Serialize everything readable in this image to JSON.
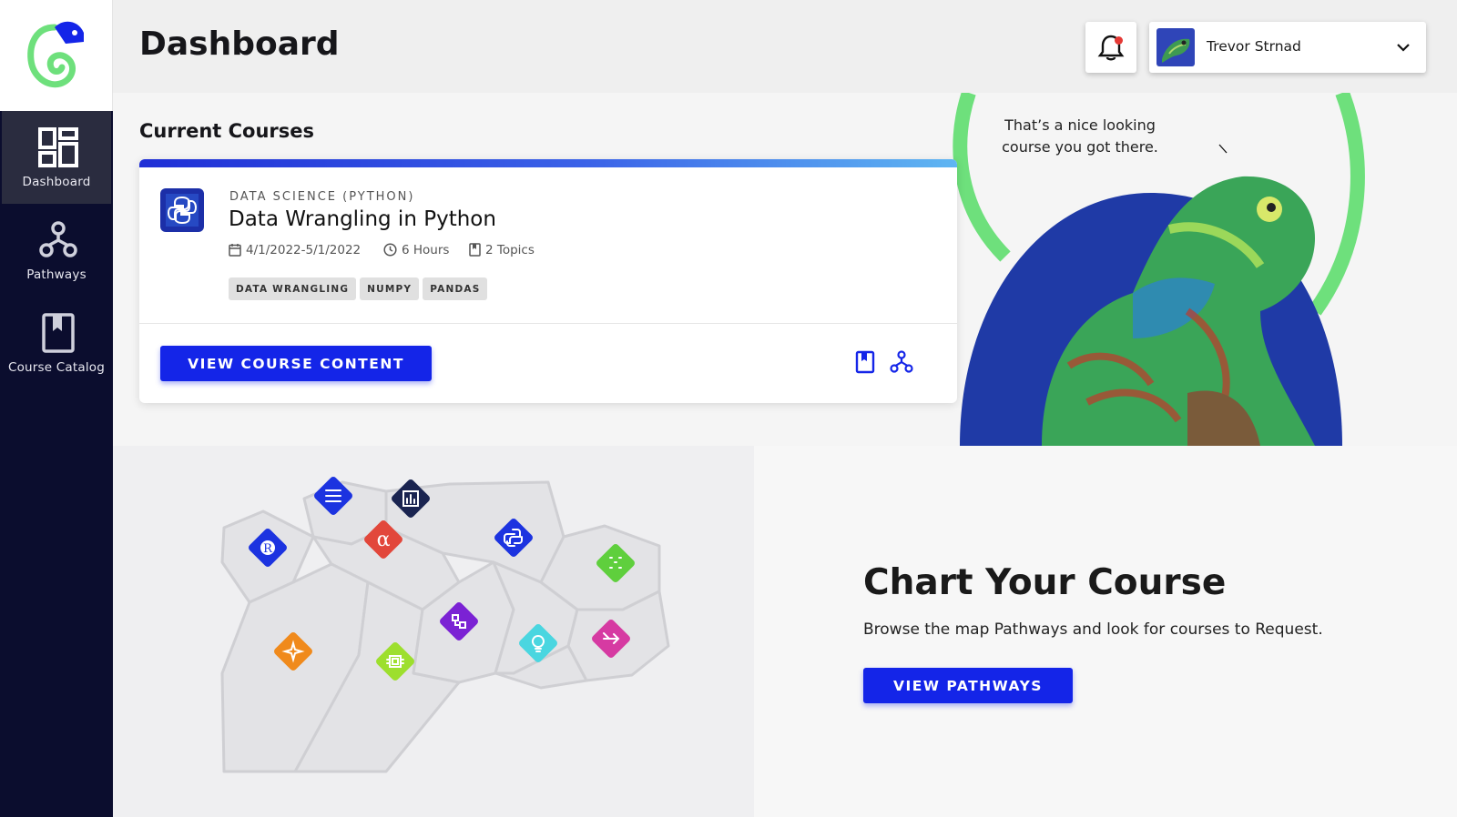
{
  "sidebar": {
    "items": [
      {
        "label": "Dashboard",
        "icon": "dashboard-grid-icon",
        "active": true
      },
      {
        "label": "Pathways",
        "icon": "pathways-nodes-icon",
        "active": false
      },
      {
        "label": "Course Catalog",
        "icon": "bookmark-book-icon",
        "active": false
      }
    ]
  },
  "header": {
    "title": "Dashboard",
    "user": {
      "name": "Trevor Strnad"
    }
  },
  "current_courses": {
    "heading": "Current Courses",
    "course": {
      "category": "DATA SCIENCE (PYTHON)",
      "title": "Data Wrangling in Python",
      "dates": "4/1/2022-5/1/2022",
      "duration": "6 Hours",
      "topics": "2 Topics",
      "tags": [
        "DATA WRANGLING",
        "NUMPY",
        "PANDAS"
      ],
      "button_label": "VIEW COURSE CONTENT"
    }
  },
  "hero": {
    "quote": "That’s a nice looking course you got there."
  },
  "map": {
    "icons": [
      "list-icon",
      "chart-icon",
      "r-language-icon",
      "alpha-icon",
      "python-icon",
      "sparkle-dots-icon",
      "network-icon",
      "sparkles-icon",
      "chip-icon",
      "lightbulb-head-icon",
      "merge-arrow-icon"
    ]
  },
  "cta": {
    "title": "Chart Your Course",
    "subtitle": "Browse the map Pathways and look for courses to Request.",
    "button_label": "VIEW PATHWAYS"
  },
  "colors": {
    "primary": "#1425e8",
    "sidebar": "#0b0d2e",
    "brand_green": "#6ee07c"
  }
}
